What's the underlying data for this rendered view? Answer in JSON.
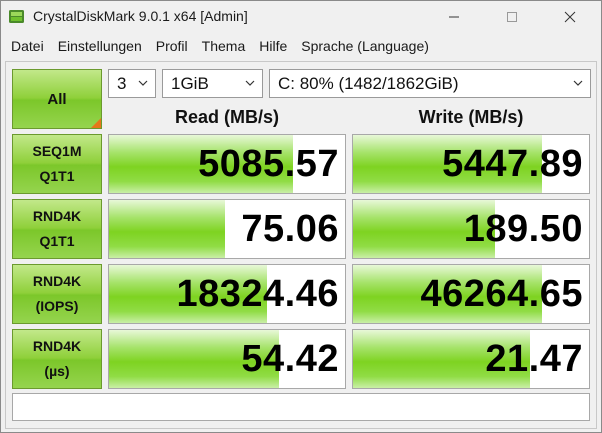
{
  "window": {
    "title": "CrystalDiskMark 9.0.1 x64 [Admin]"
  },
  "menu": {
    "items": [
      "Datei",
      "Einstellungen",
      "Profil",
      "Thema",
      "Hilfe",
      "Sprache (Language)"
    ]
  },
  "controls": {
    "all_label": "All",
    "count": "3",
    "size": "1GiB",
    "drive": "C: 80% (1482/1862GiB)"
  },
  "headers": {
    "read": "Read (MB/s)",
    "write": "Write (MB/s)"
  },
  "rows": [
    {
      "line1": "SEQ1M",
      "line2": "Q1T1",
      "read": "5085.57",
      "write": "5447.89",
      "read_fill": 0.78,
      "write_fill": 0.8
    },
    {
      "line1": "RND4K",
      "line2": "Q1T1",
      "read": "75.06",
      "write": "189.50",
      "read_fill": 0.49,
      "write_fill": 0.6
    },
    {
      "line1": "RND4K",
      "line2": "(IOPS)",
      "read": "18324.46",
      "write": "46264.65",
      "read_fill": 0.67,
      "write_fill": 0.8
    },
    {
      "line1": "RND4K",
      "line2": "(µs)",
      "read": "54.42",
      "write": "21.47",
      "read_fill": 0.72,
      "write_fill": 0.75
    }
  ],
  "status_text": "",
  "colors": {
    "bar_green": "#7ed321",
    "label_green": "#8fd03a",
    "corner_orange": "#e6771b"
  }
}
